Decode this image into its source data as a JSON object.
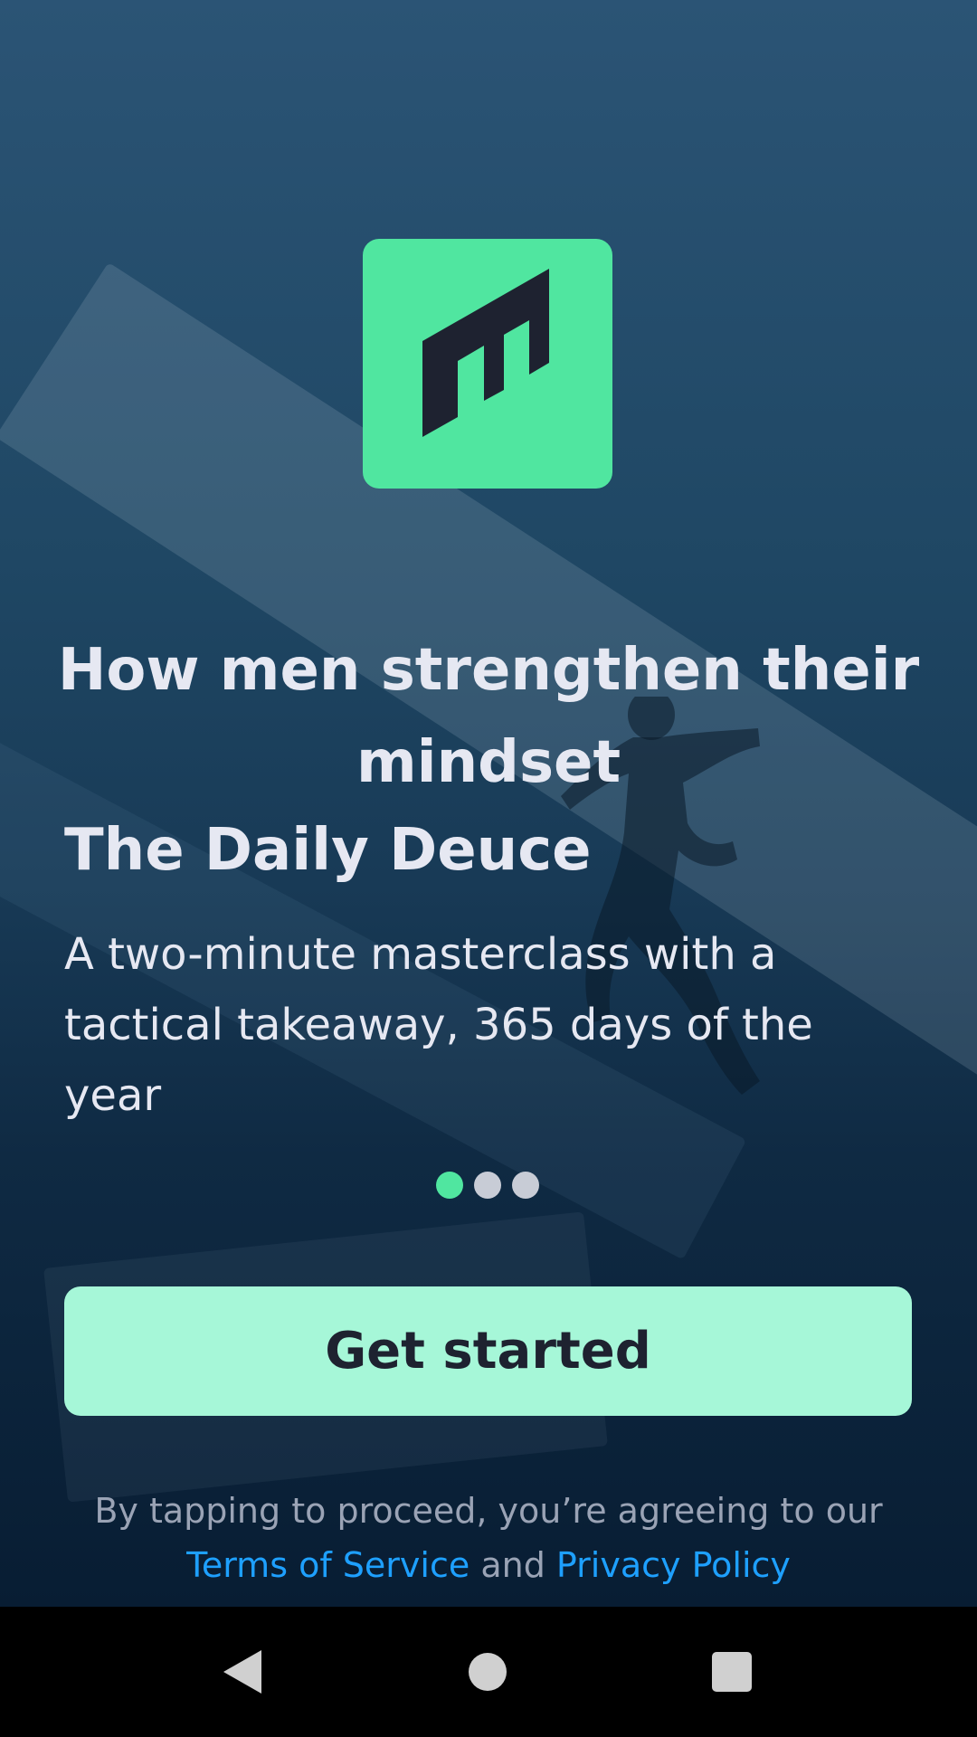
{
  "brand": {
    "accent_color": "#50e6a0",
    "logo_icon": "m-logo-icon"
  },
  "onboarding": {
    "headline": "How men strengthen their mindset",
    "subtitle": "The Daily Deuce",
    "description": "A two-minute masterclass with a tactical takeaway, 365 days of the year",
    "pagination": {
      "total": 3,
      "current": 1
    },
    "cta_label": "Get started"
  },
  "legal": {
    "prefix": "By tapping to proceed, you’re agreeing to our",
    "terms_label": "Terms of Service",
    "conjunction": "and",
    "privacy_label": "Privacy Policy",
    "link_color": "#1ea0ff"
  },
  "navigation_bar": {
    "back_icon": "back-triangle-icon",
    "home_icon": "home-circle-icon",
    "recents_icon": "recents-square-icon"
  }
}
